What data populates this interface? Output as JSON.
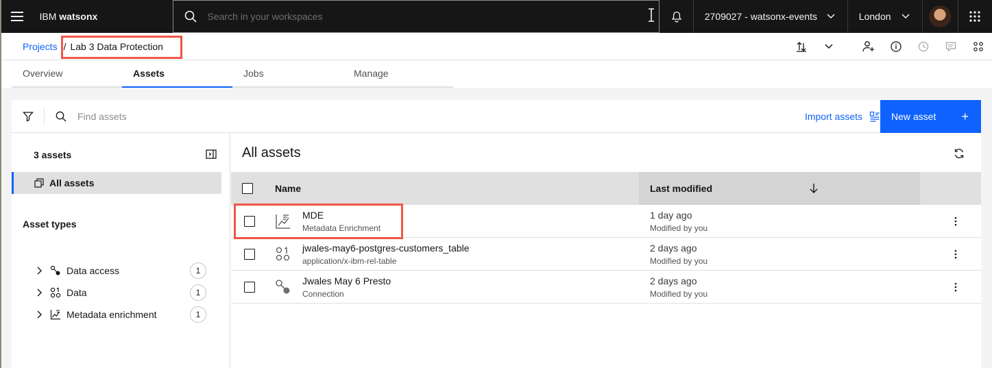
{
  "header": {
    "brand_prefix": "IBM",
    "brand_name": "watsonx",
    "search_placeholder": "Search in your workspaces",
    "account": "2709027 - watsonx-events",
    "region": "London"
  },
  "breadcrumb": {
    "parent": "Projects",
    "separator": "/",
    "current": "Lab 3 Data Protection"
  },
  "tabs": [
    {
      "label": "Overview",
      "active": false
    },
    {
      "label": "Assets",
      "active": true
    },
    {
      "label": "Jobs",
      "active": false
    },
    {
      "label": "Manage",
      "active": false
    }
  ],
  "toolbar": {
    "find_placeholder": "Find assets",
    "import_label": "Import assets",
    "new_asset_label": "New asset",
    "new_asset_plus": "+"
  },
  "sidebar": {
    "count_label": "3 assets",
    "all_assets_label": "All assets",
    "asset_types_title": "Asset types",
    "types": [
      {
        "label": "Data access",
        "count": "1",
        "icon": "connection-icon"
      },
      {
        "label": "Data",
        "count": "1",
        "icon": "data-icon"
      },
      {
        "label": "Metadata enrichment",
        "count": "1",
        "icon": "chart-icon"
      }
    ]
  },
  "assets": {
    "title": "All assets",
    "columns": {
      "name": "Name",
      "last_modified": "Last modified"
    },
    "rows": [
      {
        "name": "MDE",
        "type": "Metadata Enrichment",
        "date": "1 day ago",
        "by": "Modified by you",
        "icon": "metadata-enrichment-icon",
        "highlighted": true
      },
      {
        "name": "jwales-may6-postgres-customers_table",
        "type": "application/x-ibm-rel-table",
        "date": "2 days ago",
        "by": "Modified by you",
        "icon": "data-table-icon",
        "highlighted": false
      },
      {
        "name": "Jwales May 6 Presto",
        "type": "Connection",
        "date": "2 days ago",
        "by": "Modified by you",
        "icon": "connection-icon",
        "highlighted": false
      }
    ]
  },
  "colors": {
    "accent": "#0f62fe",
    "header_bg": "#161616",
    "highlight_box": "#ee5746"
  }
}
